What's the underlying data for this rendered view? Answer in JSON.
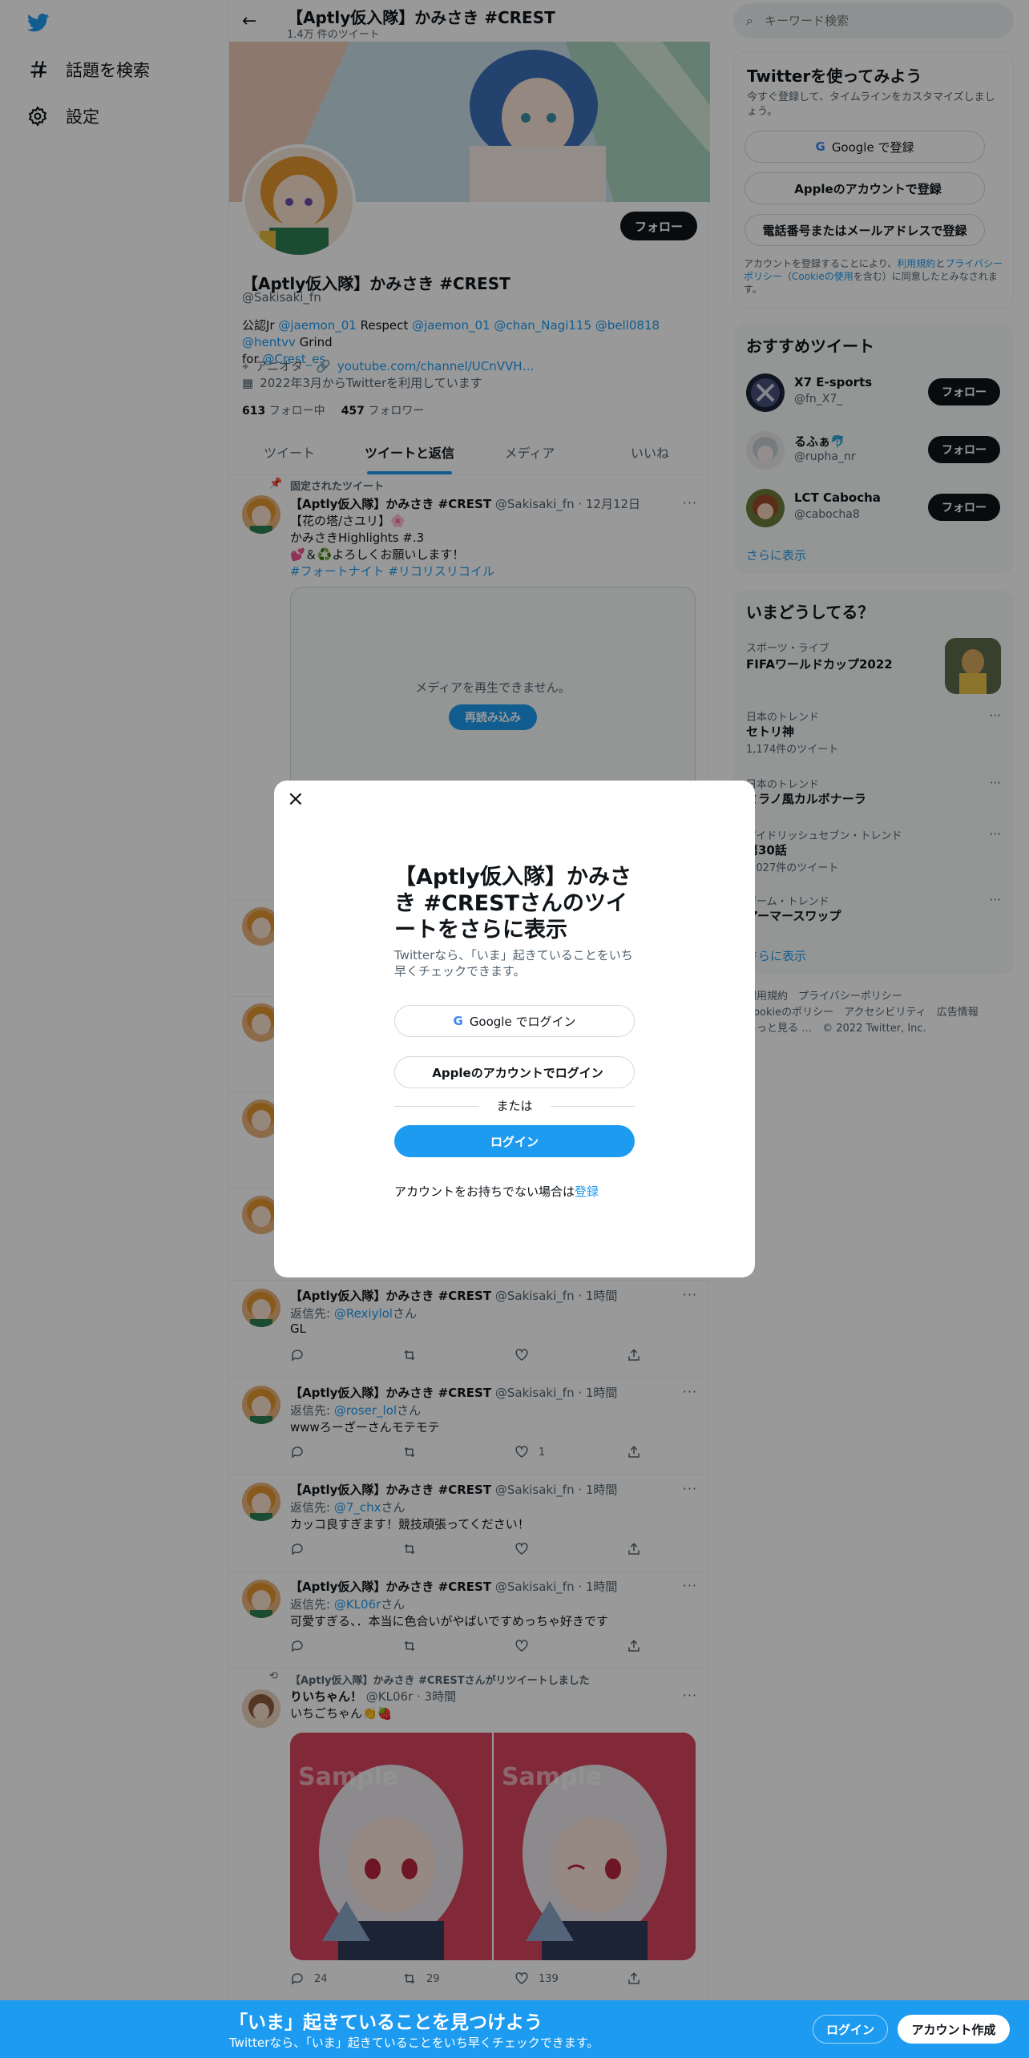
{
  "nav": {
    "explore_label": "話題を検索",
    "settings_label": "設定"
  },
  "header": {
    "title": "【Aptly仮入隊】かみさき #CREST",
    "tweet_count": "1.4万 件のツイート"
  },
  "profile": {
    "follow_label": "フォロー",
    "name": "【Aptly仮入隊】かみさき #CREST",
    "handle": "@Sakisaki_fn",
    "bio_prefix": "公認Jr ",
    "bio_mention1": "@jaemon_01",
    "bio_mid": " Respect ",
    "bio_mention2": "@jaemon_01",
    "bio_mention3": "@chan_Nagi115",
    "bio_mention4": "@bell0818",
    "bio_mention5": "@hentvv",
    "bio_grind": " Grind",
    "bio_for": "for ",
    "bio_mention6": "@Crest_es",
    "location": "アニオタ",
    "url": "youtube.com/channel/UCnVVH…",
    "joined": "2022年3月からTwitterを利用しています",
    "following_count": "613",
    "following_label": "フォロー中",
    "followers_count": "457",
    "followers_label": "フォロワー"
  },
  "tabs": [
    "ツイート",
    "ツイートと返信",
    "メディア",
    "いいね"
  ],
  "pinned": {
    "label": "固定されたツイート",
    "name": "【Aptly仮入隊】かみさき #CREST",
    "meta": "@Sakisaki_fn · 12月12日",
    "line1": "【花の塔/さユリ】🌸",
    "line2": "かみさきHighlights #.3",
    "line3": "💕＆♻️よろしくお願いします！",
    "hashtags": "#フォートナイト #リコリスリコイル",
    "media_error": "メディアを再生できません。",
    "reload_label": "再読み込み"
  },
  "tweets": [
    {
      "name": "【Aptly仮入隊】かみさき #CREST",
      "meta": "@Sakisaki_fn · 1時間",
      "reply_prefix": "返信先: ",
      "reply_to": "@Rexiylol",
      "reply_suffix": "さん",
      "text": "GL",
      "likes": ""
    },
    {
      "name": "【Aptly仮入隊】かみさき #CREST",
      "meta": "@Sakisaki_fn · 1時間",
      "reply_prefix": "返信先: ",
      "reply_to": "@roser_lol",
      "reply_suffix": "さん",
      "text": "wwwろーざーさんモテモテ",
      "likes": "1"
    },
    {
      "name": "【Aptly仮入隊】かみさき #CREST",
      "meta": "@Sakisaki_fn · 1時間",
      "reply_prefix": "返信先: ",
      "reply_to": "@7_chx",
      "reply_suffix": "さん",
      "text": "カッコ良すぎます！競技頑張ってください！",
      "likes": ""
    },
    {
      "name": "【Aptly仮入隊】かみさき #CREST",
      "meta": "@Sakisaki_fn · 1時間",
      "reply_prefix": "返信先: ",
      "reply_to": "@KL06r",
      "reply_suffix": "さん",
      "text": "可愛すぎる、．本当に色合いがやばいですめっちゃ好きです",
      "likes": ""
    }
  ],
  "retweet": {
    "rt_label": "【Aptly仮入隊】かみさき #CRESTさんがリツイートしました",
    "name": "りいちゃん！",
    "meta": "@KL06r · 3時間",
    "text": "いちごちゃん👏🍓",
    "sample_text": "Sample",
    "replies": "24",
    "retweets": "29",
    "likes": "139"
  },
  "search": {
    "placeholder": "キーワード検索"
  },
  "signup": {
    "title": "Twitterを使ってみよう",
    "subtitle": "今すぐ登録して、タイムラインをカスタマイズしましょう。",
    "google_label": "Google で登録",
    "apple_label": "Appleのアカウントで登録",
    "phone_label": "電話番号またはメールアドレスで登録",
    "terms_prefix": "アカウントを登録することにより、",
    "terms_link": "利用規約",
    "terms_and": "と",
    "privacy_link": "プライバシーポリシー",
    "cookie_open": "（",
    "cookie_link": "Cookieの使用",
    "cookie_close": "を含む）に同意したとみなされます。"
  },
  "recommended": {
    "title": "おすすめツイート",
    "users": [
      {
        "name": "X7 E-sports",
        "handle": "@fn_X7_",
        "follow": "フォロー"
      },
      {
        "name": "るふぁ🐬",
        "handle": "@rupha_nr",
        "follow": "フォロー"
      },
      {
        "name": "LCT Cabocha",
        "handle": "@cabocha8",
        "follow": "フォロー"
      }
    ],
    "more": "さらに表示"
  },
  "trends": {
    "title": "いまどうしてる？",
    "featured": {
      "category": "スポーツ・ライブ",
      "name": "FIFAワールドカップ2022"
    },
    "items": [
      {
        "category": "日本のトレンド",
        "name": "セトリ神",
        "count": "1,174件のツイート"
      },
      {
        "category": "日本のトレンド",
        "name": "ミラノ風カルボナーラ",
        "count": ""
      },
      {
        "category": "アイドリッシュセブン・トレンド",
        "name": "第30話",
        "count": "1,027件のツイート"
      },
      {
        "category": "ゲーム・トレンド",
        "name": "アーマースワップ",
        "count": ""
      }
    ],
    "more": "さらに表示"
  },
  "footer": {
    "line1": "利用規約　プライバシーポリシー",
    "line2": "Cookieのポリシー　アクセシビリティ　広告情報",
    "line3": "もっと見る …　© 2022 Twitter, Inc."
  },
  "modal": {
    "title": "【Aptly仮入隊】かみさき #CRESTさんのツイートをさらに表示",
    "subtitle": "Twitterなら、「いま」起きていることをいち早くチェックできます。",
    "google_label": "Google でログイン",
    "apple_label": "Appleのアカウントでログイン",
    "or_label": "または",
    "login_label": "ログイン",
    "signup_prompt": "アカウントをお持ちでない場合は",
    "signup_link": "登録"
  },
  "bottombar": {
    "title": "「いま」起きていることを見つけよう",
    "subtitle": "Twitterなら、「いま」起きていることをいち早くチェックできます。",
    "login_label": "ログイン",
    "signup_label": "アカウント作成"
  }
}
